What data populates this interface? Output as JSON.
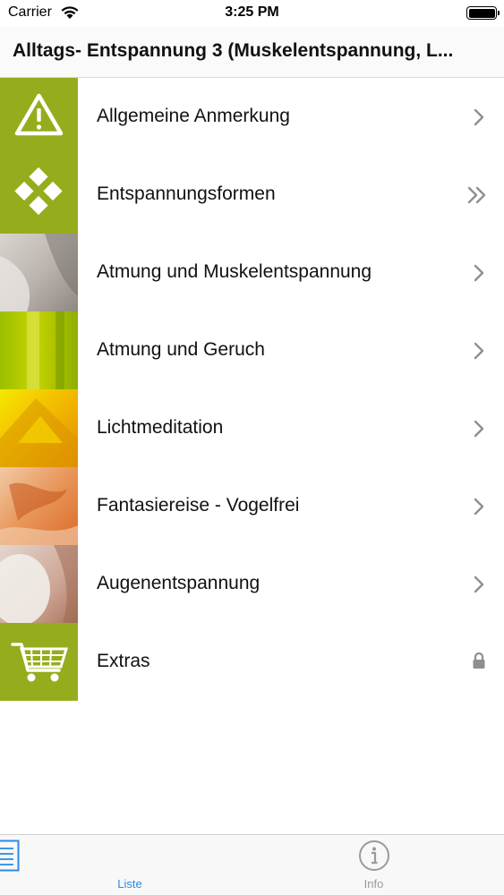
{
  "status_bar": {
    "carrier": "Carrier",
    "time": "3:25 PM"
  },
  "nav": {
    "title": "Alltags- Entspannung 3 (Muskelentspannung, L..."
  },
  "menu": {
    "items": [
      {
        "label": "Allgemeine Anmerkung",
        "icon": "warning-icon",
        "accessory": "chevron-right"
      },
      {
        "label": "Entspannungsformen",
        "icon": "diamond-pattern-icon",
        "accessory": "double-chevron-right"
      },
      {
        "label": "Atmung und Muskelentspannung",
        "icon": "photo-thumbnail",
        "accessory": "chevron-right"
      },
      {
        "label": "Atmung und Geruch",
        "icon": "photo-thumbnail",
        "accessory": "chevron-right"
      },
      {
        "label": "Lichtmeditation",
        "icon": "photo-thumbnail",
        "accessory": "chevron-right"
      },
      {
        "label": "Fantasiereise - Vogelfrei",
        "icon": "photo-thumbnail",
        "accessory": "chevron-right"
      },
      {
        "label": "Augenentspannung",
        "icon": "photo-thumbnail",
        "accessory": "chevron-right"
      },
      {
        "label": "Extras",
        "icon": "shopping-cart-icon",
        "accessory": "lock"
      }
    ]
  },
  "tabs": {
    "liste": {
      "label": "Liste",
      "icon": "list-icon",
      "active": true
    },
    "info": {
      "label": "Info",
      "icon": "info-icon",
      "active": false
    }
  },
  "colors": {
    "brand_green": "#95ad1c",
    "tab_active": "#2a8ce6",
    "tab_inactive": "#9a9a9a",
    "chevron": "#8e8e93"
  }
}
